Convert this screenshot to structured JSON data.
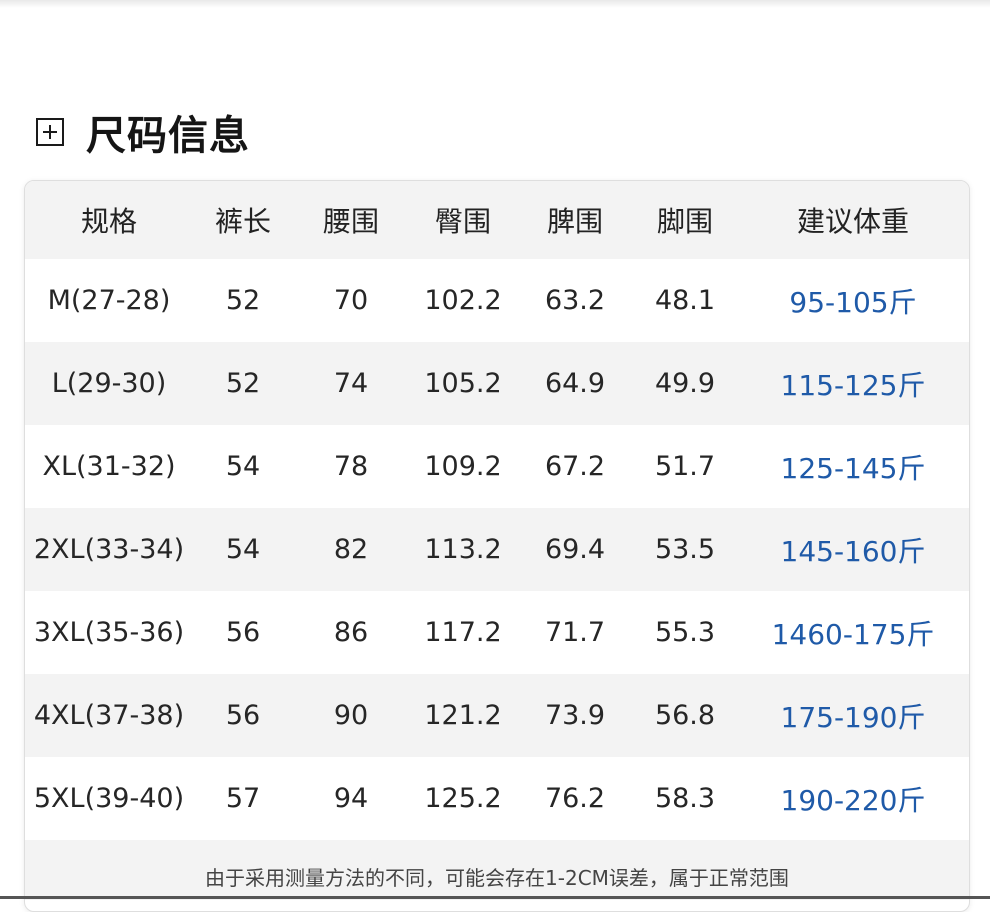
{
  "title": "尺码信息",
  "headers": [
    "规格",
    "裤长",
    "腰围",
    "臀围",
    "脾围",
    "脚围",
    "建议体重"
  ],
  "rows": [
    [
      "M(27-28)",
      "52",
      "70",
      "102.2",
      "63.2",
      "48.1",
      "95-105斤"
    ],
    [
      "L(29-30)",
      "52",
      "74",
      "105.2",
      "64.9",
      "49.9",
      "115-125斤"
    ],
    [
      "XL(31-32)",
      "54",
      "78",
      "109.2",
      "67.2",
      "51.7",
      "125-145斤"
    ],
    [
      "2XL(33-34)",
      "54",
      "82",
      "113.2",
      "69.4",
      "53.5",
      "145-160斤"
    ],
    [
      "3XL(35-36)",
      "56",
      "86",
      "117.2",
      "71.7",
      "55.3",
      "1460-175斤"
    ],
    [
      "4XL(37-38)",
      "56",
      "90",
      "121.2",
      "73.9",
      "56.8",
      "175-190斤"
    ],
    [
      "5XL(39-40)",
      "57",
      "94",
      "125.2",
      "76.2",
      "58.3",
      "190-220斤"
    ]
  ],
  "note": "由于采用测量方法的不同，可能会存在1-2CM误差，属于正常范围",
  "colors": {
    "weight_text": "#1f5aa8",
    "stripe": "#f3f3f3"
  }
}
